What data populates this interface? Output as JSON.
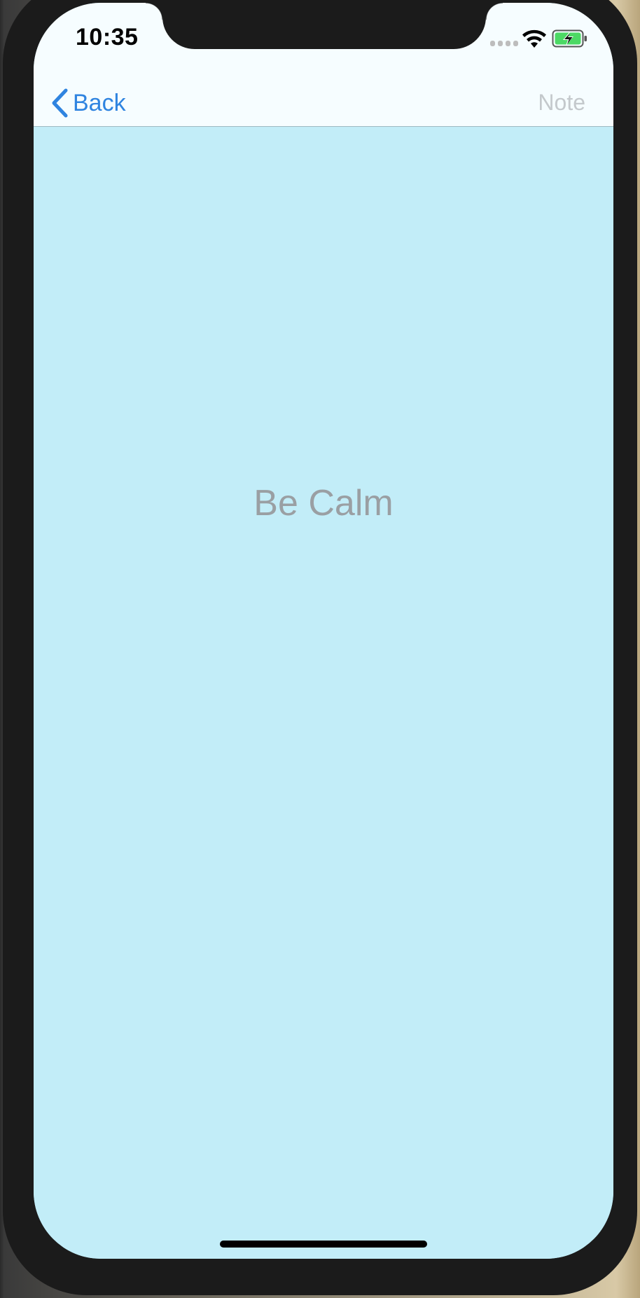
{
  "status_bar": {
    "time": "10:35",
    "signal_icon": "signal-bars-icon",
    "wifi_icon": "wifi-icon",
    "battery_icon": "battery-charging-icon",
    "battery_color": "#4cd964"
  },
  "nav_bar": {
    "back_label": "Back",
    "back_icon": "chevron-left-icon",
    "right_button_label": "Note",
    "accent_color": "#2f84e0"
  },
  "main": {
    "message": "Be Calm",
    "background_color": "#c2edf8"
  }
}
